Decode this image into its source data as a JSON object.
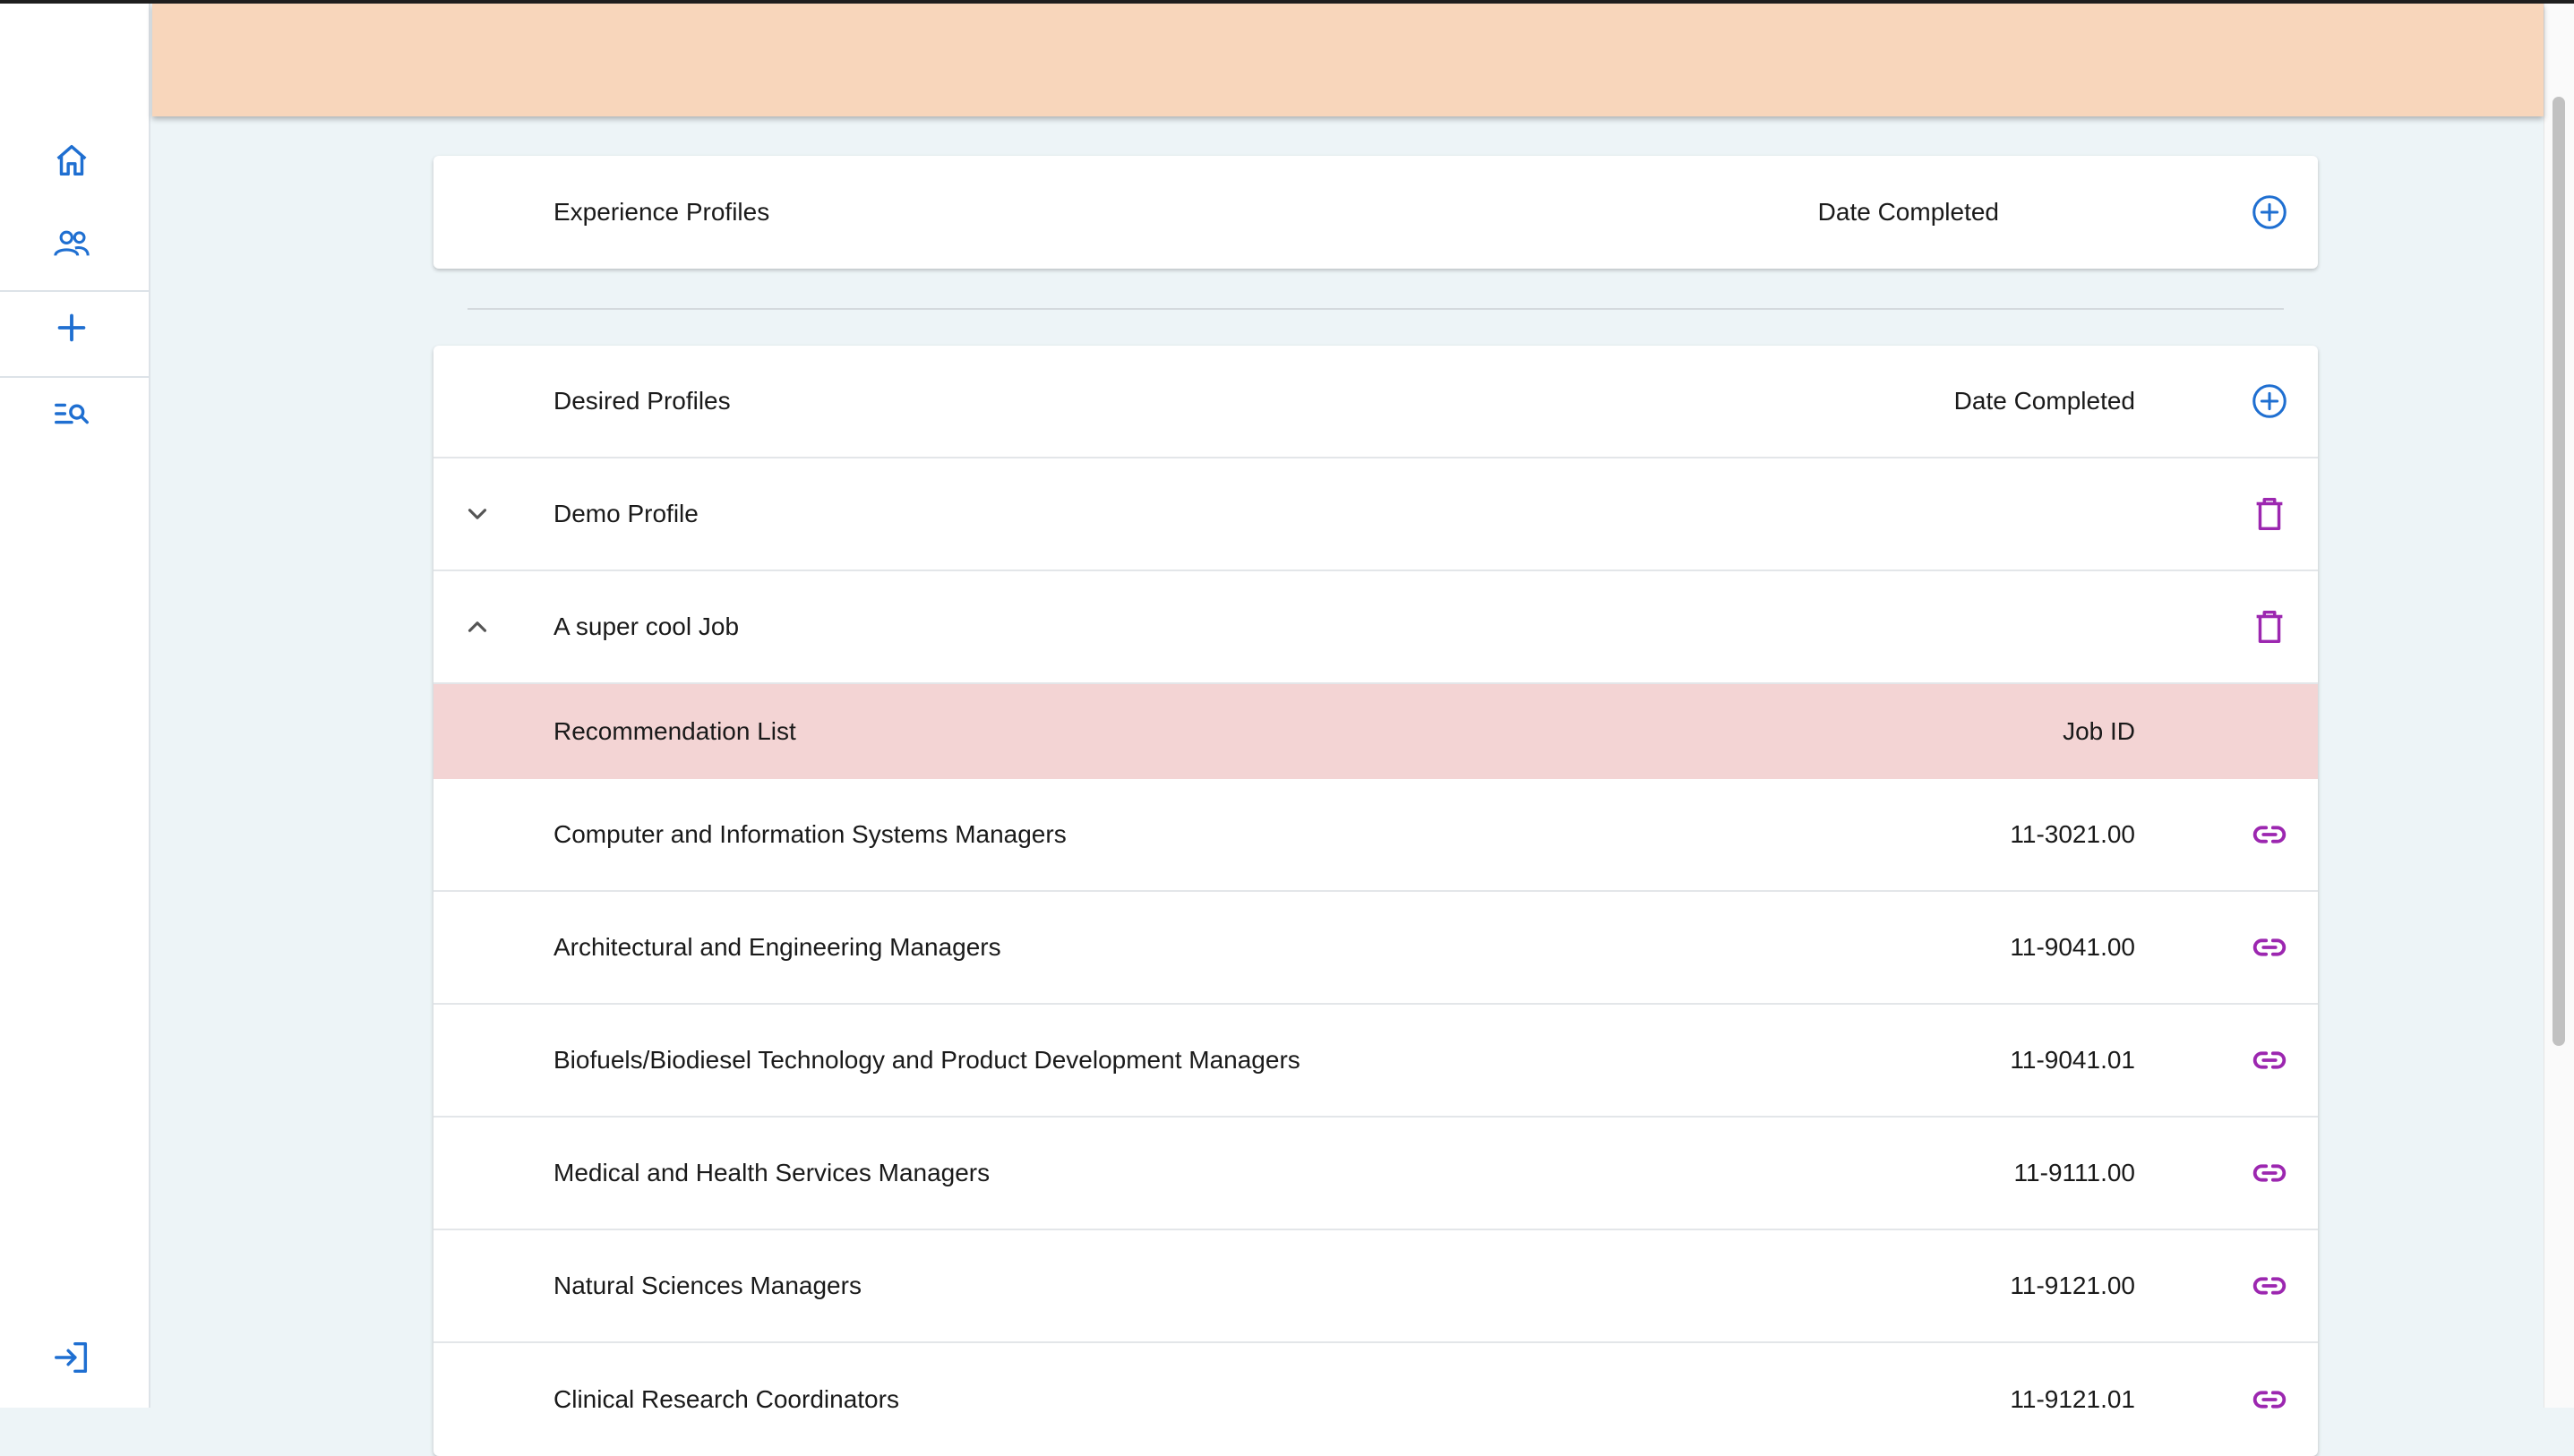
{
  "sidebar": {
    "items": [
      {
        "name": "home-icon"
      },
      {
        "name": "people-icon"
      },
      {
        "name": "add-icon"
      },
      {
        "name": "search-list-icon"
      }
    ],
    "bottom": {
      "name": "login-icon"
    }
  },
  "experience": {
    "title": "Experience Profiles",
    "date_header": "Date Completed",
    "add_icon": "add-circle-icon"
  },
  "desired": {
    "title": "Desired Profiles",
    "date_header": "Date Completed",
    "add_icon": "add-circle-icon",
    "profiles": [
      {
        "name": "Demo Profile",
        "expanded": false
      },
      {
        "name": "A super cool Job",
        "expanded": true
      }
    ]
  },
  "recommendations": {
    "header": "Recommendation List",
    "id_header": "Job ID",
    "items": [
      {
        "title": "Computer and Information Systems Managers",
        "job_id": "11-3021.00"
      },
      {
        "title": "Architectural and Engineering Managers",
        "job_id": "11-9041.00"
      },
      {
        "title": "Biofuels/Biodiesel Technology and Product Development Managers",
        "job_id": "11-9041.01"
      },
      {
        "title": "Medical and Health Services Managers",
        "job_id": "11-9111.00"
      },
      {
        "title": "Natural Sciences Managers",
        "job_id": "11-9121.00"
      },
      {
        "title": "Clinical Research Coordinators",
        "job_id": "11-9121.01"
      }
    ]
  },
  "colors": {
    "accent_blue": "#1f6fd1",
    "accent_purple": "#9c27b0",
    "header_bg": "#f8d6bb",
    "rec_header_bg": "#f3d4d4",
    "page_bg": "#edf4f7"
  }
}
